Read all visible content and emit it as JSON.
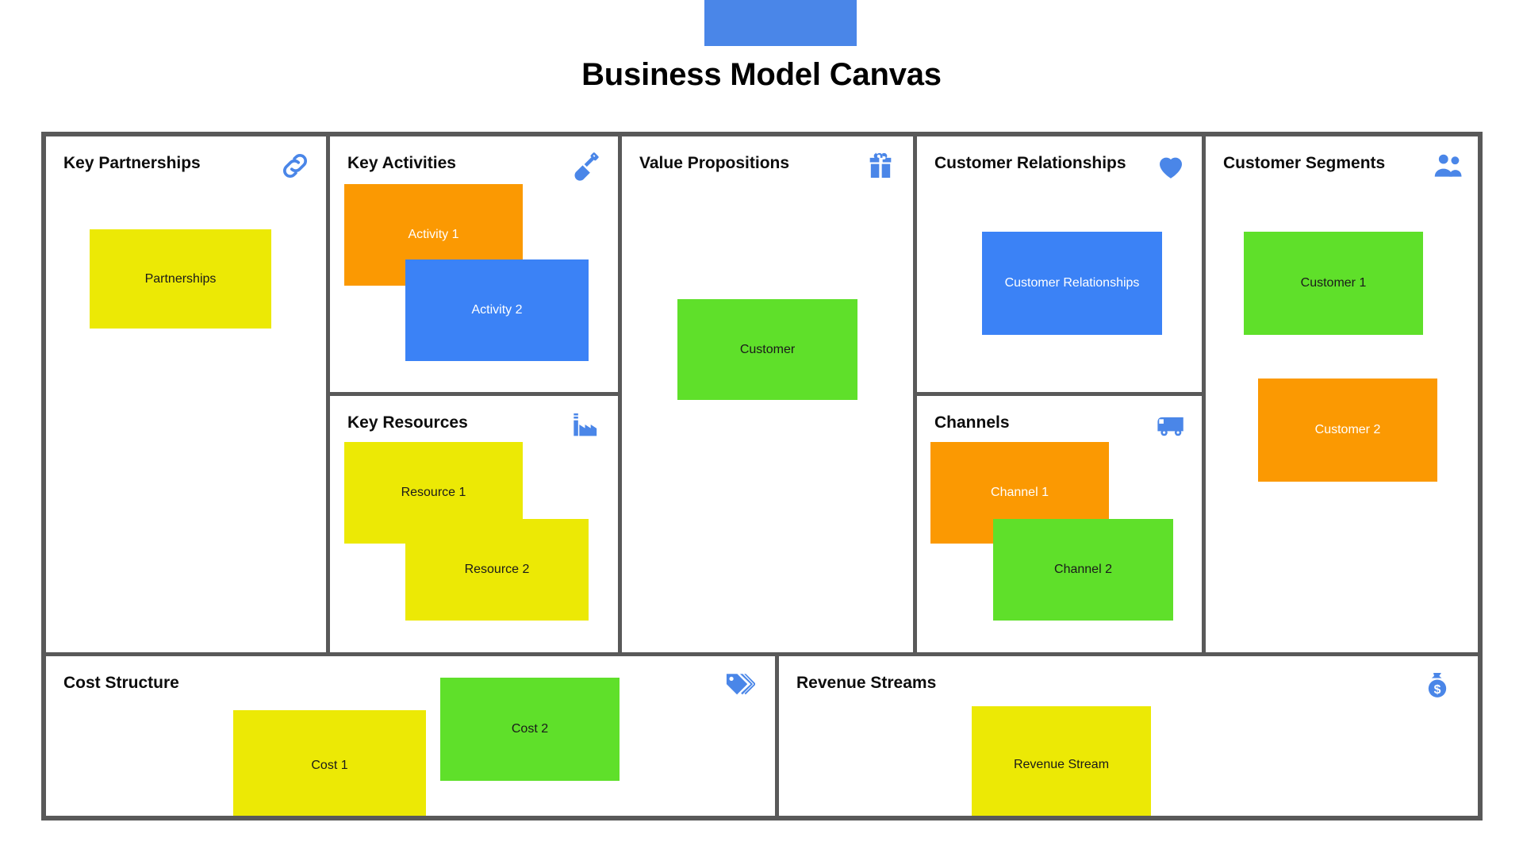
{
  "header": {
    "title": "Business Model Canvas",
    "chip_color": "#4a86e8"
  },
  "palette": {
    "yellow": "#ece905",
    "orange": "#fb9902",
    "blue": "#3b82f6",
    "green": "#5fe02a",
    "border": "#595959",
    "icon_blue": "#4a86e8"
  },
  "blocks": [
    {
      "key": "key-partnerships",
      "title": "Key Partnerships",
      "icon": "chain-link-icon",
      "notes": [
        {
          "label": "Partnerships",
          "color": "#ece905",
          "text_tone": "dark"
        }
      ]
    },
    {
      "key": "key-activities",
      "title": "Key Activities",
      "icon": "shovel-icon",
      "notes": [
        {
          "label": "Activity 1",
          "color": "#fb9902",
          "text_tone": "light"
        },
        {
          "label": "Activity 2",
          "color": "#3b82f6",
          "text_tone": "light"
        }
      ]
    },
    {
      "key": "key-resources",
      "title": "Key Resources",
      "icon": "factory-icon",
      "notes": [
        {
          "label": "Resource 1",
          "color": "#ece905",
          "text_tone": "dark"
        },
        {
          "label": "Resource 2",
          "color": "#ece905",
          "text_tone": "dark"
        }
      ]
    },
    {
      "key": "value-propositions",
      "title": "Value Propositions",
      "icon": "gift-icon",
      "notes": [
        {
          "label": "Customer",
          "color": "#5fe02a",
          "text_tone": "dark"
        }
      ]
    },
    {
      "key": "customer-relationships",
      "title": "Customer Relationships",
      "icon": "heart-icon",
      "notes": [
        {
          "label": "Customer Relationships",
          "color": "#3b82f6",
          "text_tone": "light"
        }
      ]
    },
    {
      "key": "channels",
      "title": "Channels",
      "icon": "delivery-truck-icon",
      "notes": [
        {
          "label": "Channel 1",
          "color": "#fb9902",
          "text_tone": "light"
        },
        {
          "label": "Channel 2",
          "color": "#5fe02a",
          "text_tone": "dark"
        }
      ]
    },
    {
      "key": "customer-segments",
      "title": "Customer Segments",
      "icon": "people-icon",
      "notes": [
        {
          "label": "Customer 1",
          "color": "#5fe02a",
          "text_tone": "dark"
        },
        {
          "label": "Customer 2",
          "color": "#fb9902",
          "text_tone": "light"
        }
      ]
    },
    {
      "key": "cost-structure",
      "title": "Cost Structure",
      "icon": "price-tags-icon",
      "notes": [
        {
          "label": "Cost 1",
          "color": "#ece905",
          "text_tone": "dark"
        },
        {
          "label": "Cost 2",
          "color": "#5fe02a",
          "text_tone": "dark"
        }
      ]
    },
    {
      "key": "revenue-streams",
      "title": "Revenue Streams",
      "icon": "money-bag-icon",
      "notes": [
        {
          "label": "Revenue Stream",
          "color": "#ece905",
          "text_tone": "dark"
        }
      ]
    }
  ]
}
